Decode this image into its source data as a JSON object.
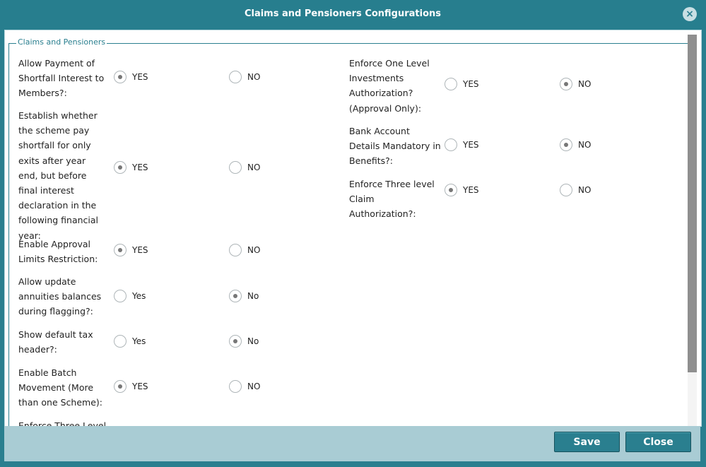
{
  "dialog": {
    "title": "Claims and Pensioners Configurations",
    "close_icon": "×",
    "section_legend": "Claims and Pensioners",
    "left": [
      {
        "label": "Allow Payment of Shortfall Interest to Members?:",
        "opt1": "YES",
        "opt2": "NO",
        "selected": 1
      },
      {
        "label": "Establish whether the scheme pay shortfall for only exits after year end, but before final interest declaration in the following financial year:",
        "opt1": "YES",
        "opt2": "NO",
        "selected": 1
      },
      {
        "label": "Enable Approval Limits Restriction:",
        "opt1": "YES",
        "opt2": "NO",
        "selected": 1
      },
      {
        "label": "Allow update annuities balances during flagging?:",
        "opt1": "Yes",
        "opt2": "No",
        "selected": 2
      },
      {
        "label": "Show default tax header?:",
        "opt1": "Yes",
        "opt2": "No",
        "selected": 2
      },
      {
        "label": "Enable Batch Movement (More than one Scheme):",
        "opt1": "YES",
        "opt2": "NO",
        "selected": 1
      },
      {
        "label": "Enforce Three Level",
        "opt1": "",
        "opt2": "",
        "selected": 0
      }
    ],
    "right": [
      {
        "label": "Enforce One Level Investments Authorization? (Approval Only):",
        "opt1": "YES",
        "opt2": "NO",
        "selected": 2
      },
      {
        "label": "Bank Account Details Mandatory in Benefits?:",
        "opt1": "YES",
        "opt2": "NO",
        "selected": 2
      },
      {
        "label": "Enforce Three level Claim Authorization?:",
        "opt1": "YES",
        "opt2": "NO",
        "selected": 1
      }
    ],
    "buttons": {
      "save": "Save",
      "close": "Close"
    }
  },
  "colors": {
    "accent": "#2a7f8f",
    "footer": "#a9ccd4"
  }
}
